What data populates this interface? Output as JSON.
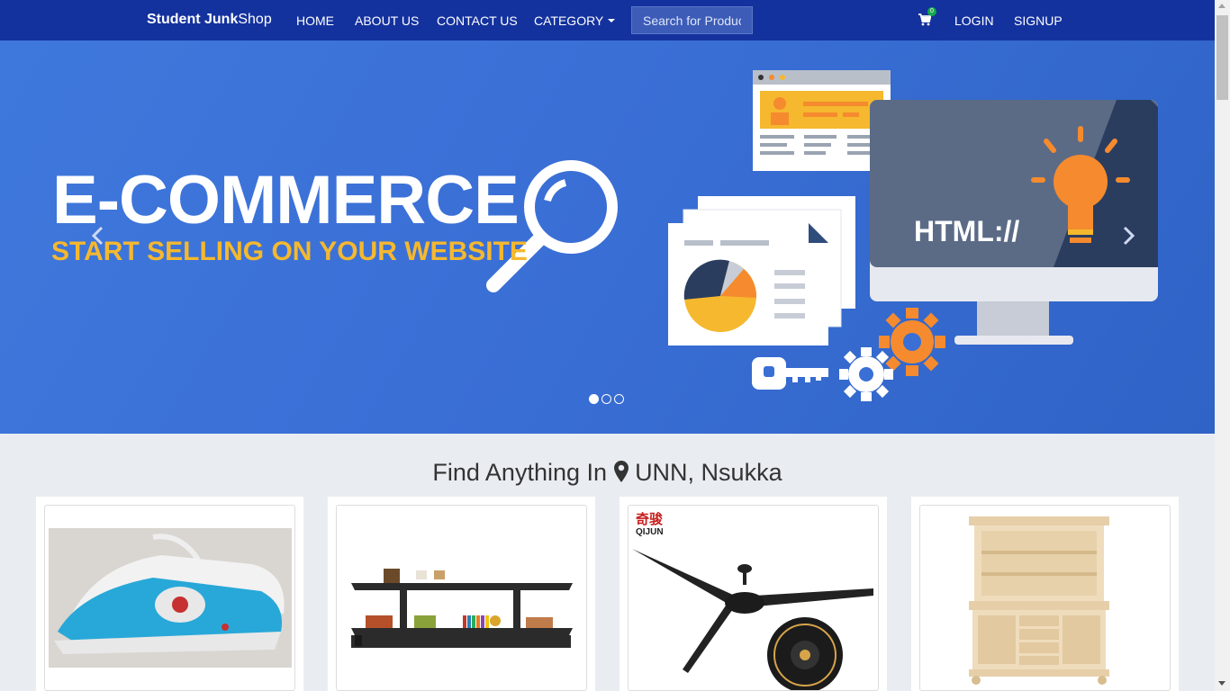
{
  "navbar": {
    "brand_bold": "Student Junk",
    "brand_rest": "Shop",
    "links": [
      "HOME",
      "ABOUT US",
      "CONTACT US",
      "CATEGORY"
    ],
    "search_placeholder": "Search for Product",
    "cart_count": "0",
    "login": "LOGIN",
    "signup": "SIGNUP"
  },
  "hero": {
    "title": "E-COMMERCE",
    "subtitle": "START SELLING ON YOUR WEBSITE",
    "monitor_text": "HTML://",
    "slide_count": 3,
    "active_slide": 1
  },
  "section": {
    "title_prefix": "Find Anything In",
    "location": "UNN, Nsukka"
  },
  "products": [
    {
      "name": "iron-thumbnail"
    },
    {
      "name": "tv-stand-thumbnail"
    },
    {
      "name": "ceiling-fan-thumbnail",
      "brand_text": "奇骏",
      "brand_latin": "QIJUN"
    },
    {
      "name": "cabinet-thumbnail"
    }
  ],
  "colors": {
    "navbar": "#14329e",
    "hero": "#3a6fd6",
    "accent_yellow": "#f5b82e",
    "accent_orange": "#f58b2e",
    "badge": "#13a84a"
  }
}
